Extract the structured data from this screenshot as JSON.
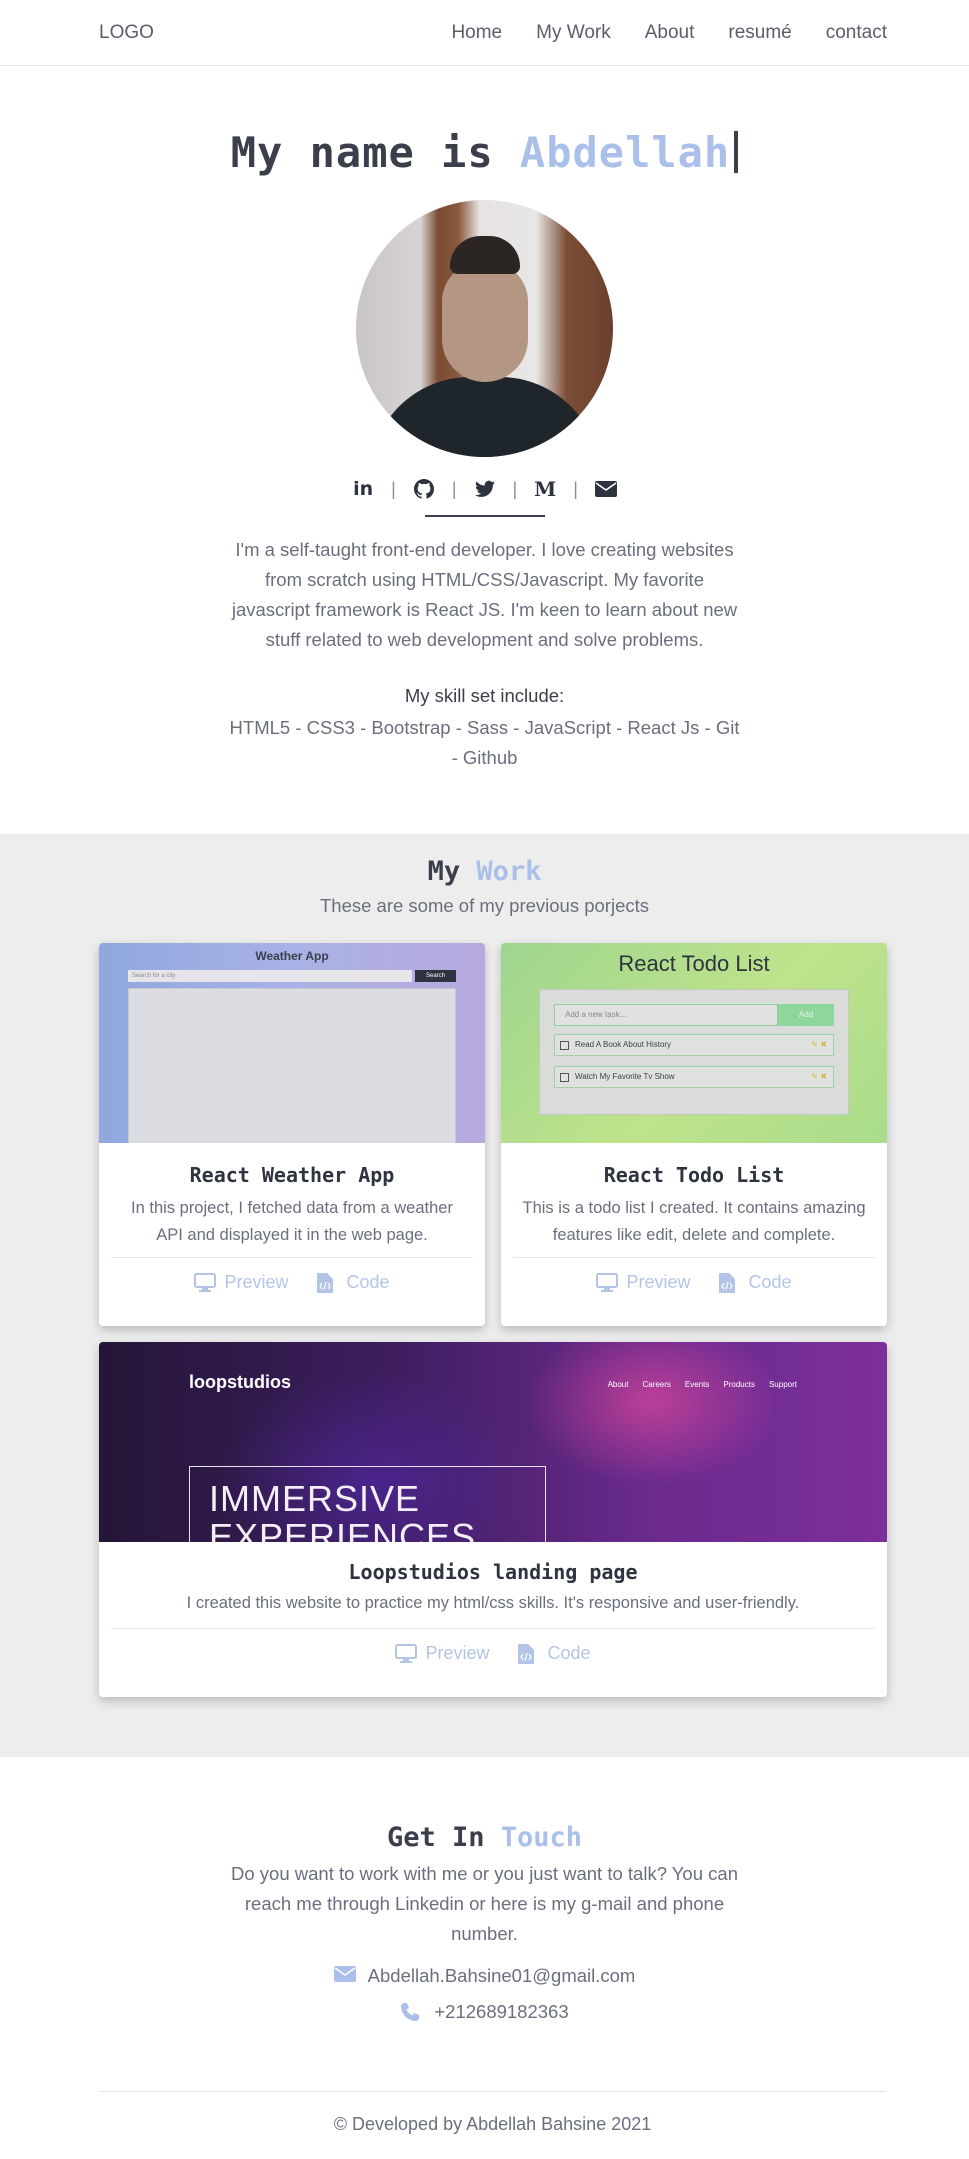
{
  "nav": {
    "logo": "LOGO",
    "links": [
      "Home",
      "My Work",
      "About",
      "resumé",
      "contact"
    ]
  },
  "hero": {
    "title_prefix": "My name is ",
    "title_name": "Abdellah",
    "social_icons": [
      "linkedin-icon",
      "github-icon",
      "twitter-icon",
      "medium-icon",
      "envelope-icon"
    ],
    "social_labels": {
      "linkedin": "in",
      "medium": "M"
    },
    "bio": "I'm a self-taught front-end developer. I love creating websites from scratch using HTML/CSS/Javascript. My favorite javascript framework is React JS. I'm keen to learn about new stuff related to web development and solve problems.",
    "skills_heading": "My skill set include:",
    "skills": "HTML5 - CSS3 - Bootstrap - Sass - JavaScript - React Js - Git - Github"
  },
  "work": {
    "title_prefix": "My ",
    "title_accent": "Work",
    "subtitle": "These are some of my previous porjects",
    "preview_label": "Preview",
    "code_label": "Code",
    "projects": [
      {
        "title": "React Weather App",
        "description": "In this project, I fetched data from a weather API and displayed it in the web page.",
        "thumb": {
          "heading": "Weather App",
          "search_placeholder": "Search for a city",
          "button": "Search"
        }
      },
      {
        "title": "React Todo List",
        "description": "This is a todo list I created. It contains amazing features like edit, delete and complete.",
        "thumb": {
          "heading": "React Todo List",
          "input_placeholder": "Add a new task...",
          "button": "Add",
          "items": [
            "Read A Book About History",
            "Watch My Favorite Tv Show"
          ]
        }
      },
      {
        "title": "Loopstudios landing page",
        "description": "I created this website to practice my html/css skills. It's responsive and user-friendly.",
        "thumb": {
          "brand": "loopstudios",
          "nav": [
            "About",
            "Careers",
            "Events",
            "Products",
            "Support"
          ],
          "hero_line1": "IMMERSIVE",
          "hero_line2": "EXPERIENCES"
        }
      }
    ]
  },
  "contact": {
    "title_prefix": "Get In ",
    "title_accent": "Touch",
    "description": "Do you want to work with me or you just want to talk? You can reach me through Linkedin or here is my g-mail and phone number.",
    "email": "Abdellah.Bahsine01@gmail.com",
    "phone": "+212689182363"
  },
  "footer": {
    "text": "© Developed by Abdellah Bahsine 2021"
  },
  "colors": {
    "accent": "#aac0ea",
    "text_dark": "#3b3f4b",
    "section_bg": "#ededed"
  }
}
